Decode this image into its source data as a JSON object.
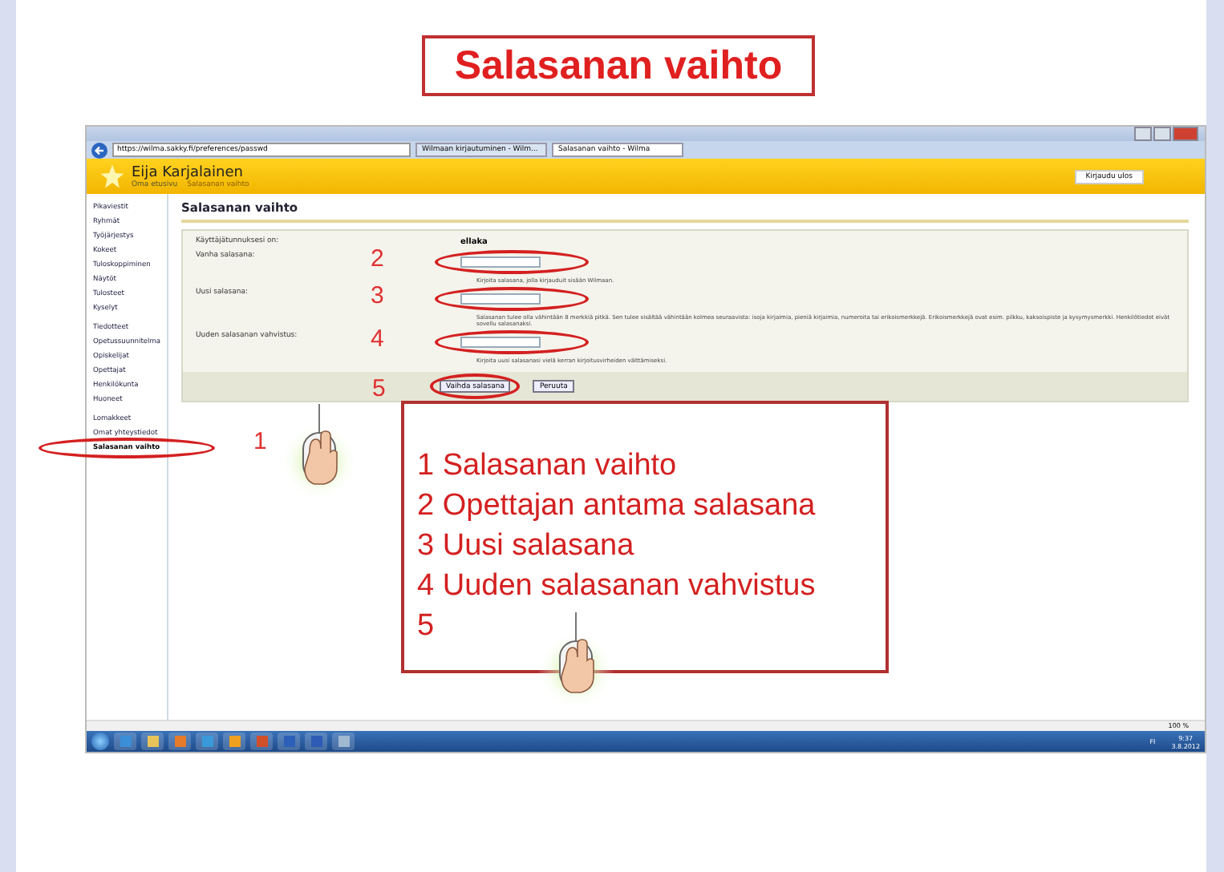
{
  "slide_title": "Salasanan vaihto",
  "browser": {
    "address": "https://wilma.sakky.fi/preferences/passwd",
    "tabs": [
      {
        "label": "Wilmaan kirjautuminen - Wilm...",
        "selected": false
      },
      {
        "label": "Salasanan vaihto - Wilma",
        "selected": true
      }
    ]
  },
  "header": {
    "user": "Eija Karjalainen",
    "breadcrumb": [
      "Oma etusivu",
      "Salasanan vaihto"
    ],
    "logout": "Kirjaudu ulos"
  },
  "sidebar": {
    "groups": [
      [
        {
          "label": "Pikaviestit",
          "selected": false
        },
        {
          "label": "Ryhmät",
          "selected": false
        },
        {
          "label": "Työjärjestys",
          "selected": false
        },
        {
          "label": "Kokeet",
          "selected": false
        },
        {
          "label": "Tuloskoppiminen",
          "selected": false
        },
        {
          "label": "Näytöt",
          "selected": false
        },
        {
          "label": "Tulosteet",
          "selected": false
        },
        {
          "label": "Kyselyt",
          "selected": false
        }
      ],
      [
        {
          "label": "Tiedotteet",
          "selected": false
        },
        {
          "label": "Opetussuunnitelma",
          "selected": false
        },
        {
          "label": "Opiskelijat",
          "selected": false
        },
        {
          "label": "Opettajat",
          "selected": false
        },
        {
          "label": "Henkilökunta",
          "selected": false
        },
        {
          "label": "Huoneet",
          "selected": false
        }
      ],
      [
        {
          "label": "Lomakkeet",
          "selected": false
        },
        {
          "label": "Omat yhteystiedot",
          "selected": false
        },
        {
          "label": "Salasanan vaihto",
          "selected": true
        }
      ]
    ]
  },
  "page": {
    "heading": "Salasanan vaihto",
    "username_label": "Käyttäjätunnuksesi on:",
    "username": "ellaka",
    "fields": [
      {
        "label": "Vanha salasana:",
        "hint": "Kirjoita salasana, jolla kirjauduit sisään Wilmaan."
      },
      {
        "label": "Uusi salasana:",
        "hint": "Salasanan tulee olla vähintään 8 merkkiä pitkä. Sen tulee sisältää vähintään kolmea seuraavista: isoja kirjaimia, pieniä kirjaimia, numeroita tai erikoismerkkejä. Erikoismerkkejä ovat esim. pilkku, kaksoispiste ja kysymysmerkki. Henkilötiedot eivät sovellu salasanaksi."
      },
      {
        "label": "Uuden salasanan vahvistus:",
        "hint": "Kirjoita uusi salasanasi vielä kerran kirjoitusvirheiden välttämiseksi."
      }
    ],
    "buttons": [
      "Vaihda salasana",
      "Peruuta"
    ]
  },
  "zoom": "100 %",
  "taskbar": {
    "lang": "FI",
    "time": "9:37",
    "date": "3.8.2012"
  },
  "callouts": [
    "1",
    "2",
    "3",
    "4",
    "5"
  ],
  "notes": [
    "1 Salasanan vaihto",
    "2 Opettajan antama salasana",
    "3 Uusi salasana",
    "4 Uuden salasanan vahvistus",
    "5"
  ]
}
